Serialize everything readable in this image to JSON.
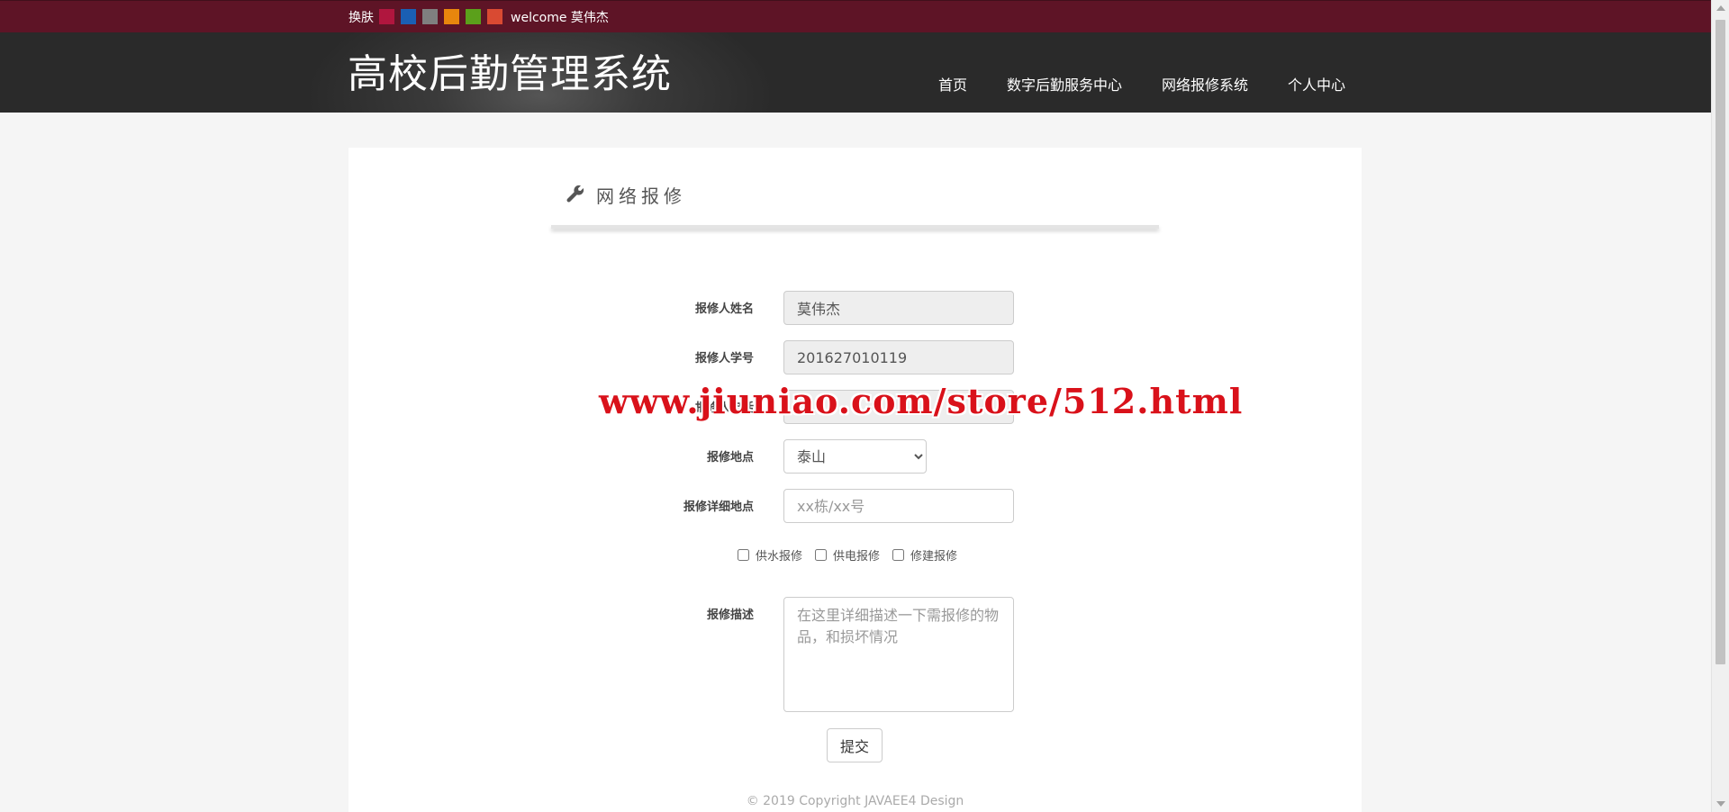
{
  "skin_bar": {
    "label": "换肤",
    "swatches": [
      "#b0163e",
      "#1a5fb4",
      "#7f7f7f",
      "#e8860d",
      "#5ba01b",
      "#d94a32"
    ],
    "welcome": "welcome 莫伟杰"
  },
  "header": {
    "title": "高校后勤管理系统",
    "nav": [
      "首页",
      "数字后勤服务中心",
      "网络报修系统",
      "个人中心"
    ]
  },
  "section": {
    "title": "网络报修"
  },
  "form": {
    "name_label": "报修人姓名",
    "name_value": "莫伟杰",
    "id_label": "报修人学号",
    "id_value": "201627010119",
    "phone_label": "报修人电话",
    "phone_value": "",
    "location_label": "报修地点",
    "location_selected": "泰山",
    "detail_label": "报修详细地点",
    "detail_placeholder": "xx栋/xx号",
    "checkboxes": [
      "供水报修",
      "供电报修",
      "修建报修"
    ],
    "desc_label": "报修描述",
    "desc_placeholder": "在这里详细描述一下需报修的物品，和损坏情况",
    "submit_label": "提交"
  },
  "footer": {
    "copyright": "© 2019 Copyright JAVAEE4 Design"
  },
  "watermark": "www.jiuniao.com/store/512.html",
  "colors": {
    "skin_bar_bg": "#5e1426",
    "header_bg": "#2e2e2e",
    "watermark": "#d9111a"
  },
  "icons": {
    "section": "wrench-icon"
  }
}
